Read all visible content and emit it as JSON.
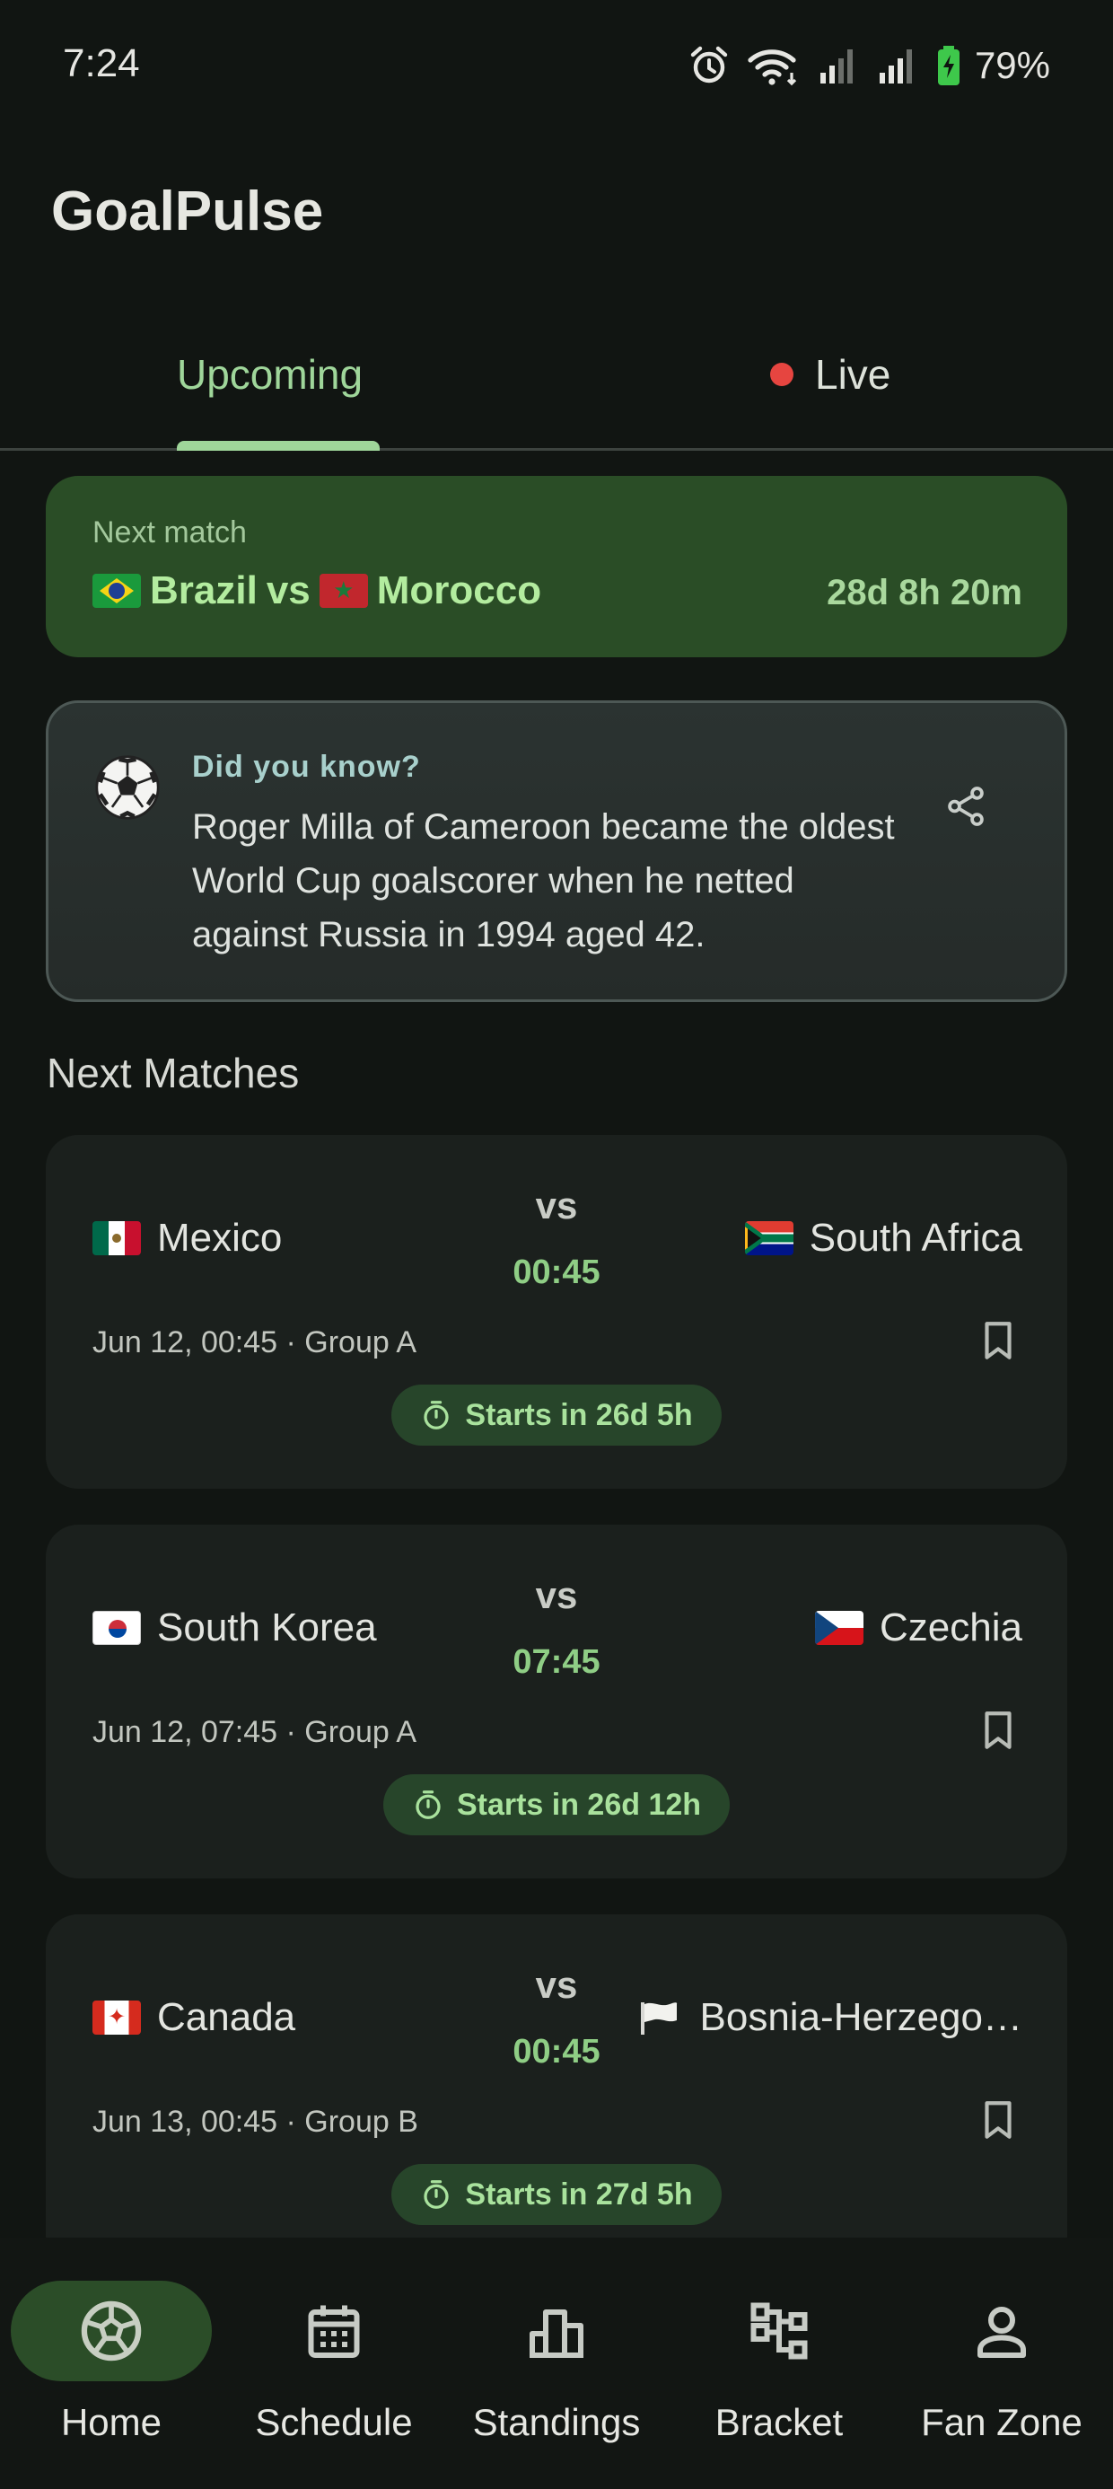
{
  "status_bar": {
    "time": "7:24",
    "battery": "79%",
    "icons": [
      "alarm-icon",
      "wifi-icon",
      "signal-icon",
      "signal-icon",
      "battery-charging-icon"
    ]
  },
  "app": {
    "title": "GoalPulse"
  },
  "tabs": [
    {
      "label": "Upcoming",
      "selected": true
    },
    {
      "label": "Live",
      "selected": false,
      "indicator_color": "#e64540"
    }
  ],
  "next_match": {
    "label": "Next match",
    "home": "Brazil",
    "vs": "vs",
    "away": "Morocco",
    "countdown": "28d 8h 20m"
  },
  "fact": {
    "title": "Did you know?",
    "text": "Roger Milla of Cameroon became the oldest World Cup goalscorer when he netted against Russia in 1994 aged 42.",
    "icon": "soccer-ball-icon",
    "share_icon": "share-icon"
  },
  "section_title": "Next Matches",
  "matches": [
    {
      "home": "Mexico",
      "away": "South Africa",
      "vs": "vs",
      "time": "00:45",
      "meta": "Jun 12, 00:45 · Group A",
      "starts": "Starts in 26d 5h"
    },
    {
      "home": "South Korea",
      "away": "Czechia",
      "vs": "vs",
      "time": "07:45",
      "meta": "Jun 12, 07:45 · Group A",
      "starts": "Starts in 26d 12h"
    },
    {
      "home": "Canada",
      "away": "Bosnia-Herzego…",
      "vs": "vs",
      "time": "00:45",
      "meta": "Jun 13, 00:45 · Group B",
      "starts": "Starts in 27d 5h"
    }
  ],
  "nav": [
    {
      "label": "Home",
      "icon": "soccer-ball-icon",
      "active": true
    },
    {
      "label": "Schedule",
      "icon": "calendar-icon",
      "active": false
    },
    {
      "label": "Standings",
      "icon": "bar-chart-icon",
      "active": false
    },
    {
      "label": "Bracket",
      "icon": "bracket-icon",
      "active": false
    },
    {
      "label": "Fan Zone",
      "icon": "person-icon",
      "active": false
    }
  ],
  "colors": {
    "background": "#111512",
    "accent": "#9fd69a",
    "banner": "#2a4d26",
    "card": "#1b201d",
    "live": "#e64540"
  }
}
